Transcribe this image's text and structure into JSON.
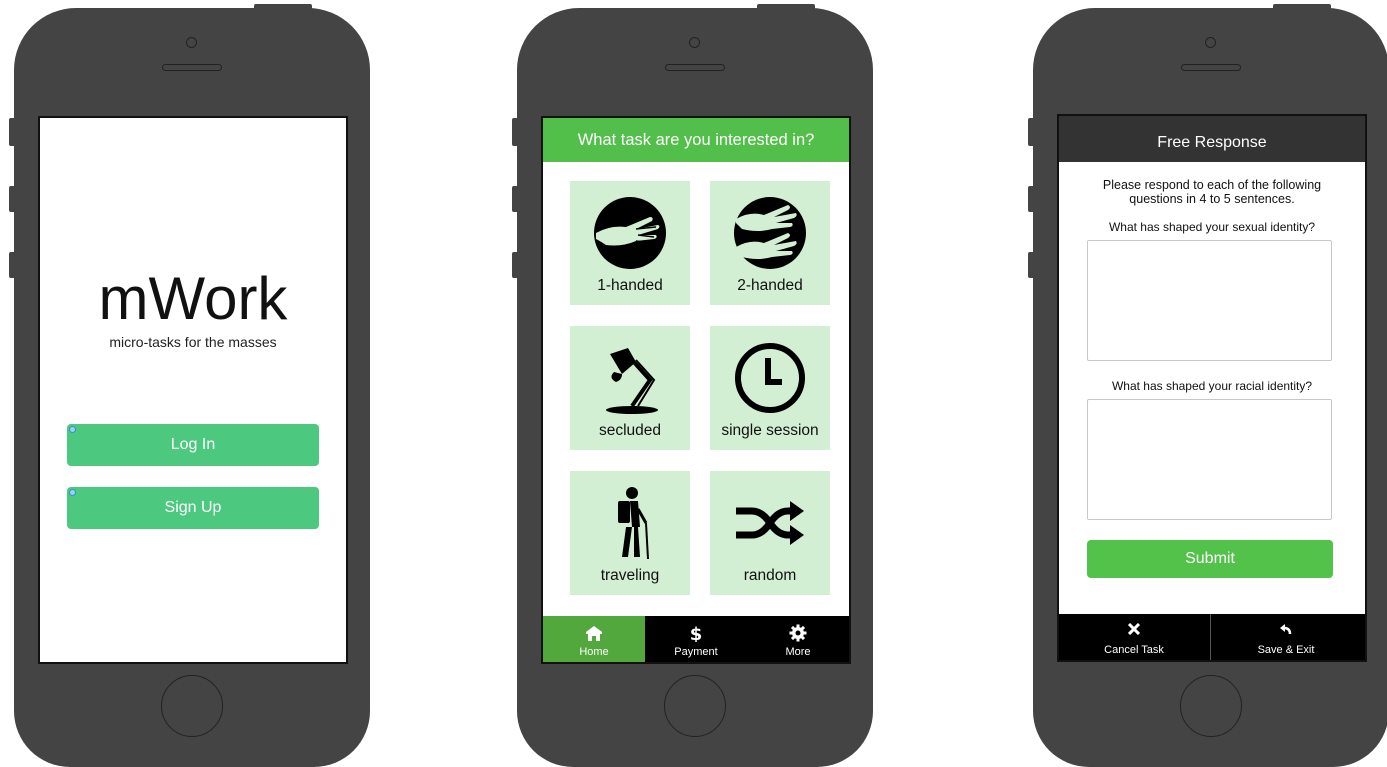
{
  "phone1": {
    "logo": "mWork",
    "tagline": "micro-tasks for the masses",
    "login_label": "Log In",
    "signup_label": "Sign Up"
  },
  "phone2": {
    "header": "What task are you interested in?",
    "tiles": [
      {
        "label": "1-handed",
        "icon": "one-hand-icon"
      },
      {
        "label": "2-handed",
        "icon": "two-hands-icon"
      },
      {
        "label": "secluded",
        "icon": "desk-lamp-icon"
      },
      {
        "label": "single session",
        "icon": "clock-icon"
      },
      {
        "label": "traveling",
        "icon": "hiker-icon"
      },
      {
        "label": "random",
        "icon": "shuffle-icon"
      }
    ],
    "nav": [
      {
        "label": "Home",
        "icon": "home-icon",
        "active": true
      },
      {
        "label": "Payment",
        "icon": "dollar-icon",
        "active": false
      },
      {
        "label": "More",
        "icon": "gear-icon",
        "active": false
      }
    ]
  },
  "phone3": {
    "header": "Free Response",
    "intro": "Please respond to each of the following questions in 4 to 5 sentences.",
    "question1": "What has shaped your sexual identity?",
    "question2": "What has shaped your racial identity?",
    "answer1": "",
    "answer2": "",
    "submit_label": "Submit",
    "footer": [
      {
        "label": "Cancel Task",
        "icon": "close-icon"
      },
      {
        "label": "Save & Exit",
        "icon": "reply-icon"
      }
    ]
  },
  "colors": {
    "phone_body": "#444444",
    "button_green": "#4cc97f",
    "header_green": "#52bf4a",
    "tile_bg": "#d3efd3",
    "nav_active": "#52a83c",
    "header_dark": "#333333"
  }
}
